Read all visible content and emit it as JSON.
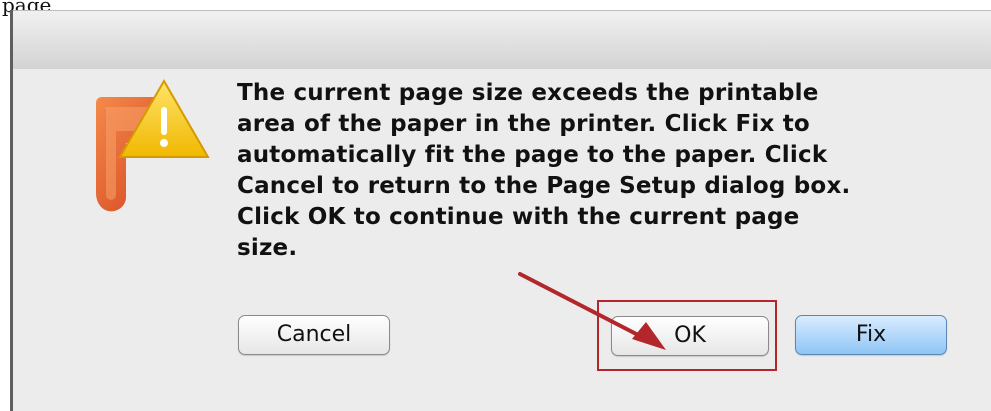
{
  "fragment": "page",
  "dialog": {
    "message": "The current page size exceeds the printable\narea of the paper in the printer. Click Fix to\nautomatically fit the page to the paper. Click\nCancel to return to the Page Setup dialog box.\nClick OK to continue with the current page\nsize.",
    "buttons": {
      "cancel": "Cancel",
      "ok": "OK",
      "fix": "Fix"
    },
    "icon": "powerpoint-warning-icon"
  },
  "colors": {
    "annotation": "#b3262b",
    "default_button": "#8fc6f6",
    "app_icon_orange": "#e8522b",
    "warning_yellow": "#f4c21b"
  }
}
